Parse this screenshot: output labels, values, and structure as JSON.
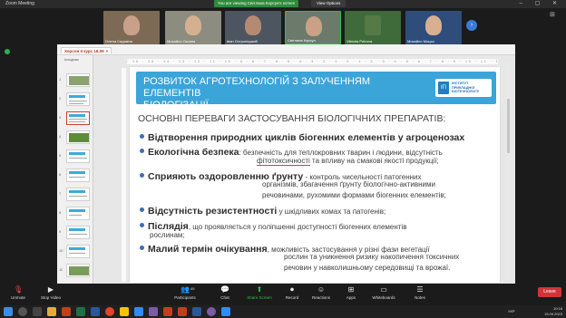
{
  "window": {
    "title": "Zoom Meeting",
    "viewing_banner": "You are viewing Світлана Корсун's screen",
    "view_options": "View Options"
  },
  "participants": [
    {
      "name": "Олена Сидякіна",
      "color": "#7d6a55"
    },
    {
      "name": "Михайло Оксана",
      "color": "#5a6b72"
    },
    {
      "name": "Іван Остропіцький",
      "color": "#4d5560"
    },
    {
      "name": "Світлана Корсун",
      "color": "#6b7a6a"
    },
    {
      "name": "Viktoria Petrova",
      "color": "#3f6b3a"
    },
    {
      "name": "Михайло Моцьо",
      "color": "#2e4d7a"
    }
  ],
  "ppt": {
    "tab_label": "Херсон II курс 18.09",
    "sidebar_title": "Ісходник",
    "thumb_numbers": [
      "1",
      "2",
      "3",
      "4",
      "5",
      "6",
      "7",
      "8",
      "9",
      "10",
      "11"
    ],
    "ruler_text": "· 16 · 15 · 14 · 13 · 12 · 11 · 10 · 9 · 8 · 7 · 6 · 5 · 4 · 3 · 2 · 1 · 0 · 1 · 2 · 3 · 4 · 5 · 6 · 7 · 8 · 9 · 10 · 11 · 12 · 13 · 14 · 15 · 16 ·"
  },
  "slide": {
    "title_line1": "РОЗВИТОК АГРОТЕХНОЛОГІЙ З ЗАЛУЧЕННЯМ ЕЛЕМЕНТІВ",
    "title_line2": "БІОЛОГІЗАЦІЇ",
    "logo_mark": "ІП",
    "logo_text": "ІНСТИТУТ ПРИКЛАДНОЇ БІОТЕХНОЛОГІЇ",
    "subtitle": "ОСНОВНІ ПЕРЕВАГИ ЗАСТОСУВАННЯ БІОЛОГІЧНИХ ПРЕПАРАТІВ:",
    "b1_head": "Відтворення природних циклів біогенних елементів у агроценозах",
    "b2_head": "Екологічна безпека",
    "b2_text": ": безпечність для теплокровних тварин і людини, відсутність",
    "b2_cont_u": "фітотоксичності",
    "b2_cont": " та впливу на смакові якості продукції;",
    "b3_head": "Сприяють оздоровленню ґрунту",
    "b3_text": " - контроль чисельності патогенних",
    "b3_cont1": "організмів, збагачення ґрунту біологічно-активними",
    "b3_cont2": "речовинами, рухомими формами біогенних елементів;",
    "b4_head": "Відсутність резистентності",
    "b4_text": " у шкідливих комах та патогенів;",
    "b5_head": "Післядія",
    "b5_text": ", що проявляється у поліпшенні доступності біогенних елементів",
    "b5_cont": "рослинам;",
    "b6_head": "Малий термін очікування",
    "b6_text": ", можливість застосування у різні фази вегетації",
    "b6_cont1": "рослин та уникнення ризику накопичення токсичних",
    "b6_cont2": "речовин у навколишньому середовищі та врожаї."
  },
  "controls": {
    "unmute": "Unmute",
    "stop_video": "Stop Video",
    "participants": "Participants",
    "participants_count": "49",
    "chat": "Chat",
    "share_screen": "Share Screen",
    "record": "Record",
    "reactions": "Reactions",
    "apps": "Apps",
    "whiteboards": "Whiteboards",
    "notes": "Notes",
    "leave": "Leave"
  },
  "taskbar": {
    "lang": "УКР",
    "time": "10:16",
    "date": "19.09.2023"
  },
  "colors": {
    "accent_blue": "#3ba4d9",
    "share_green": "#2bc24c",
    "leave_red": "#d13438"
  }
}
